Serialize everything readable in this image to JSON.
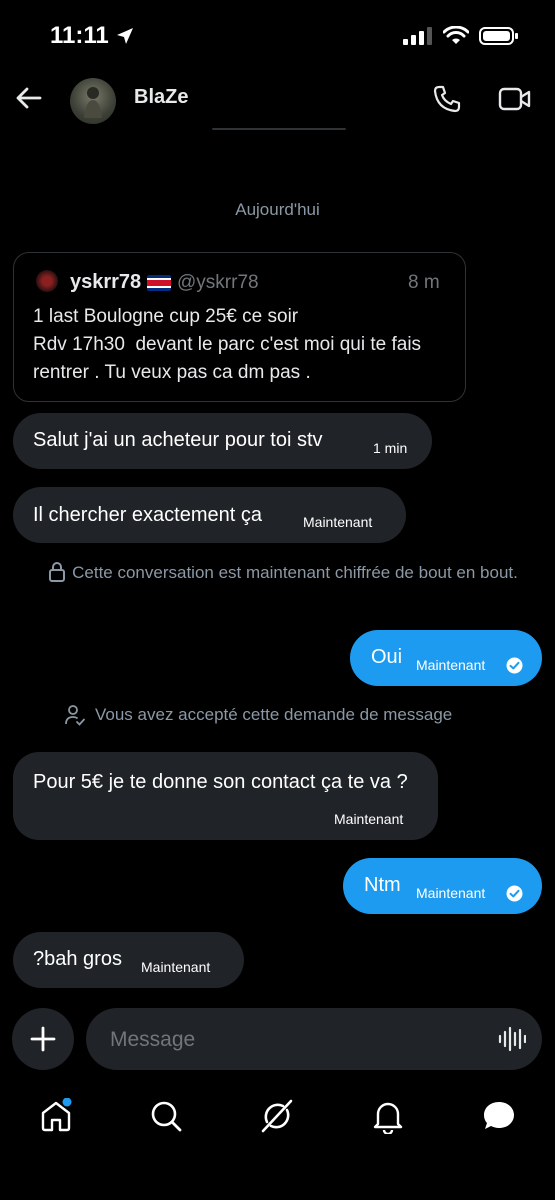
{
  "status_bar": {
    "time": "11:11"
  },
  "header": {
    "contact_name": "BlaZe"
  },
  "date_separator": "Aujourd'hui",
  "quoted_tweet": {
    "name": "yskrr78",
    "handle": "@yskrr78",
    "time": "8 m",
    "text": "1 last Boulogne cup 25€ ce soir\nRdv 17h30  devant le parc c'est moi qui te fais rentrer . Tu veux pas ca dm pas ."
  },
  "messages": [
    {
      "text": "Salut j'ai un acheteur pour toi stv",
      "time": "1 min",
      "direction": "incoming"
    },
    {
      "text": "Il chercher exactement ça",
      "time": "Maintenant",
      "direction": "incoming"
    },
    {
      "text": "Oui",
      "time": "Maintenant",
      "direction": "outgoing"
    },
    {
      "text": "Pour 5€ je te donne son contact ça te va ?",
      "time": "Maintenant",
      "direction": "incoming"
    },
    {
      "text": "Ntm",
      "time": "Maintenant",
      "direction": "outgoing"
    },
    {
      "text": "?bah gros",
      "time": "Maintenant",
      "direction": "incoming"
    }
  ],
  "system_notices": {
    "encryption": "Cette conversation est maintenant chiffrée de bout en bout.",
    "accepted": "Vous avez accepté cette demande de message"
  },
  "composer": {
    "placeholder": "Message"
  },
  "colors": {
    "accent": "#1d9bf0",
    "bubble_incoming": "#202327",
    "background": "#000000"
  },
  "nav": {
    "items": [
      "home-icon",
      "search-icon",
      "grok-icon",
      "notifications-icon",
      "messages-icon"
    ],
    "home_has_notification_dot": true
  }
}
